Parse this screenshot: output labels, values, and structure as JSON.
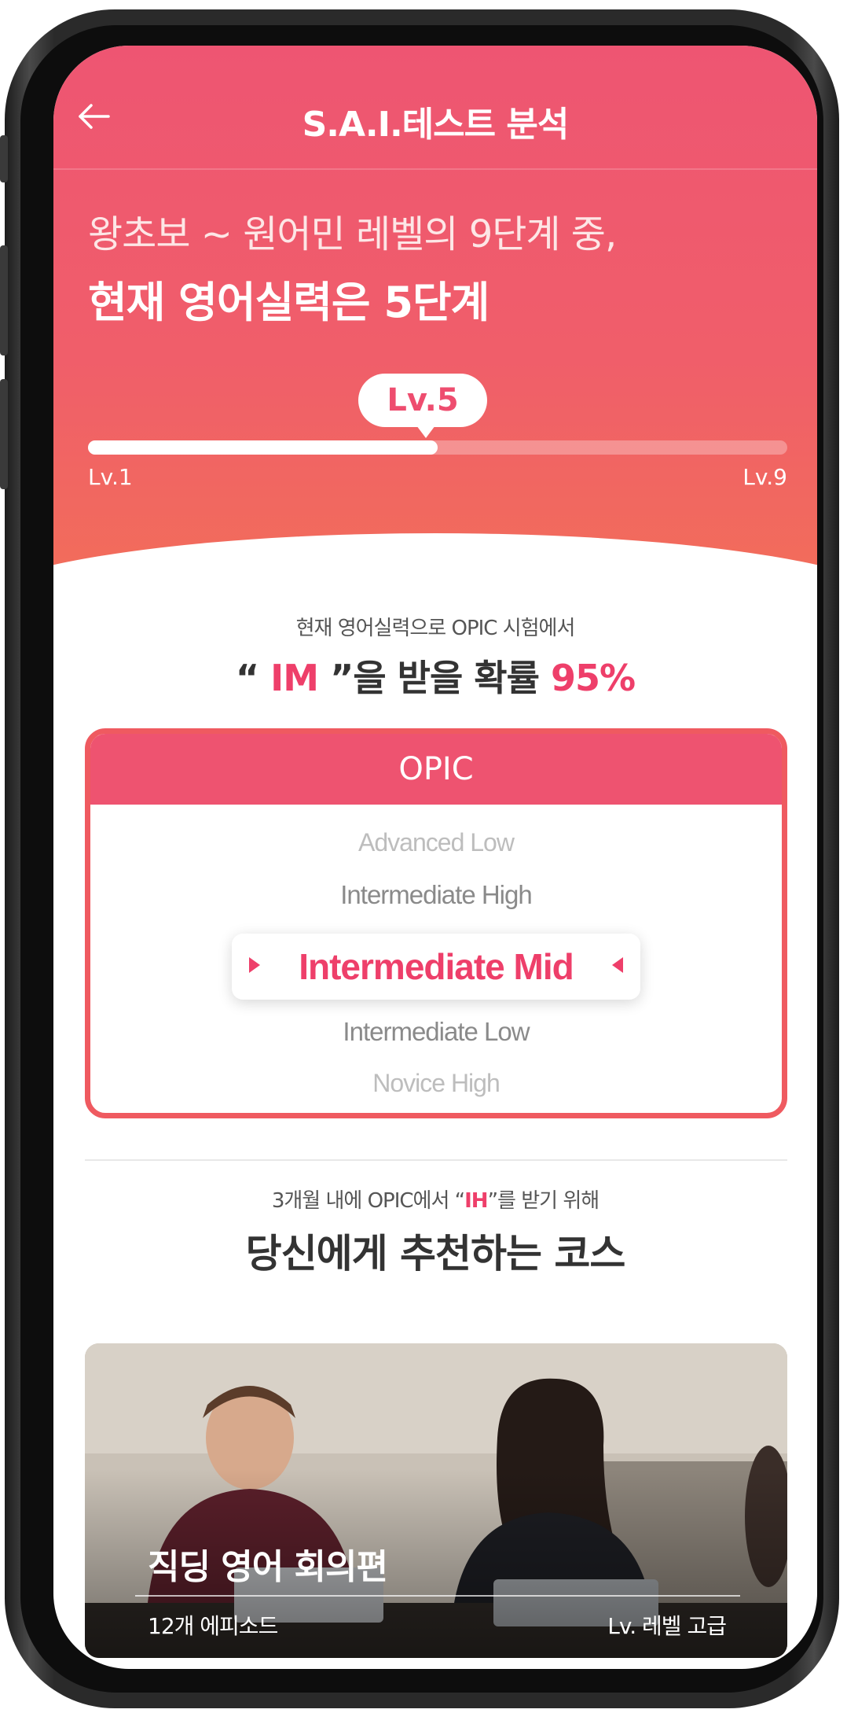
{
  "header": {
    "title": "S.A.I.테스트 분석",
    "headline_line1": "왕초보 ~ 원어민 레벨의 9단계 중,",
    "headline_line2": "현재 영어실력은 5단계"
  },
  "level": {
    "current_label": "Lv.5",
    "min_label": "Lv.1",
    "max_label": "Lv.9",
    "current": 5,
    "min": 1,
    "max": 9
  },
  "prediction": {
    "sub": "현재 영어실력으로 OPIC 시험에서",
    "grade": "IM",
    "quote_open": "“",
    "quote_close": "”",
    "suffix": "을 받을 확률",
    "percent": "95%"
  },
  "opic": {
    "header": "OPIC",
    "options": [
      "Advanced Low",
      "Intermediate High",
      "Intermediate Mid",
      "Intermediate Low",
      "Novice High"
    ],
    "selected": "Intermediate Mid"
  },
  "recommendation": {
    "sub_prefix": "3개월 내에 OPIC에서 “",
    "sub_grade": "IH",
    "sub_suffix": "”를 받기 위해",
    "main": "당신에게 추천하는 코스"
  },
  "course": {
    "title": "직딩 영어 회의편",
    "episodes": "12개 에피소드",
    "level": "Lv. 레벨 고급"
  },
  "colors": {
    "accent": "#ee3f6a",
    "header_top": "#ee5572",
    "header_bottom": "#f26f58",
    "opic_border": "#ef5a60"
  }
}
